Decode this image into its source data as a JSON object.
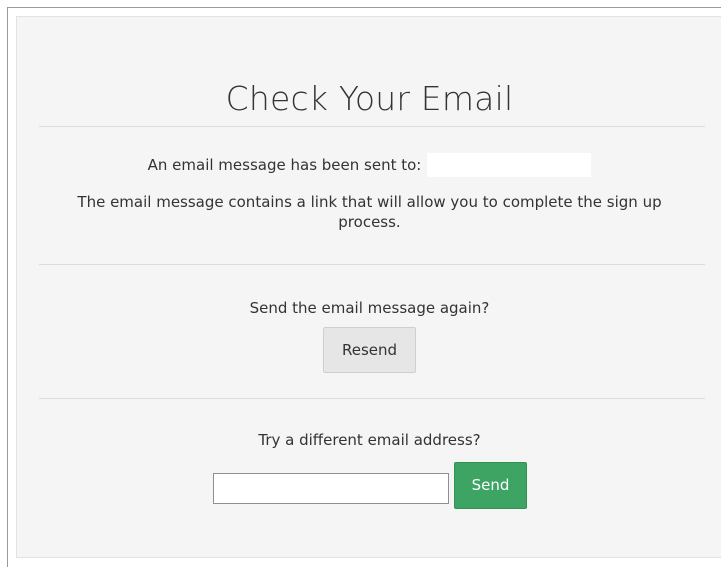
{
  "page": {
    "title": "Check Your Email"
  },
  "sent": {
    "text": "An email message has been sent to:",
    "email": ""
  },
  "info": {
    "text": "The email message contains a link that will allow you to complete the sign up process."
  },
  "resend_section": {
    "prompt": "Send the email message again?",
    "button_label": "Resend"
  },
  "different_email_section": {
    "prompt": "Try a different email address?",
    "input_value": "",
    "input_placeholder": "",
    "button_label": "Send"
  },
  "colors": {
    "panel_background": "#f5f5f5",
    "send_button": "#3ea463",
    "resend_button": "#e6e6e6"
  }
}
